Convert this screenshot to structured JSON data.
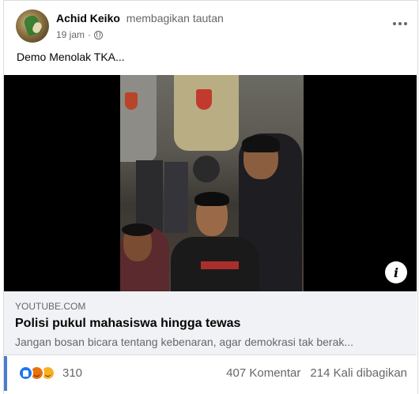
{
  "post": {
    "author": "Achid Keiko",
    "action": "membagikan tautan",
    "time": "19 jam",
    "separator": "·",
    "privacy_icon": "globe-icon",
    "text": "Demo Menolak TKA..."
  },
  "link": {
    "domain": "YOUTUBE.COM",
    "title": "Polisi pukul mahasiswa hingga tewas",
    "description": "Jangan bosan bicara tentang kebenaran, agar demokrasi tak berak..."
  },
  "media": {
    "info_glyph": "i"
  },
  "engagement": {
    "reaction_count": "310",
    "reactions": [
      "like-icon",
      "angry-icon",
      "sad-icon"
    ],
    "comments": "407 Komentar",
    "shares": "214 Kali dibagikan"
  },
  "colors": {
    "accent": "#1877f2",
    "secondary_text": "#65676b",
    "link_box": "#f0f2f5"
  }
}
